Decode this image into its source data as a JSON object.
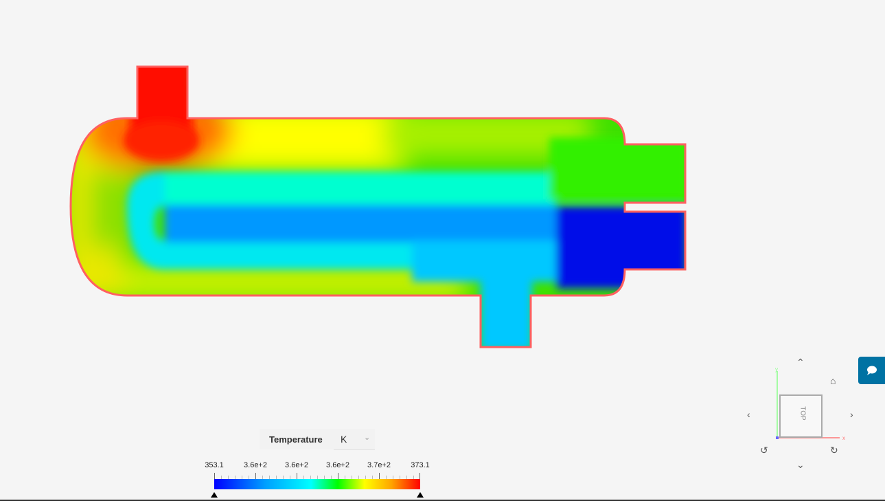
{
  "legend": {
    "title": "Temperature",
    "unit": "K",
    "ticks": [
      "353.1",
      "3.6e+2",
      "3.6e+2",
      "3.6e+2",
      "3.7e+2",
      "373.1"
    ],
    "min": 353.1,
    "max": 373.1
  },
  "viewcube": {
    "face": "TOP",
    "x_axis": "x",
    "y_axis": "y"
  },
  "icons": {
    "chat": "chat-bubble-icon",
    "home": "home-icon"
  },
  "colors": {
    "chat_button": "#0072a3",
    "hot": "#ff0000",
    "cold": "#0000ff"
  }
}
